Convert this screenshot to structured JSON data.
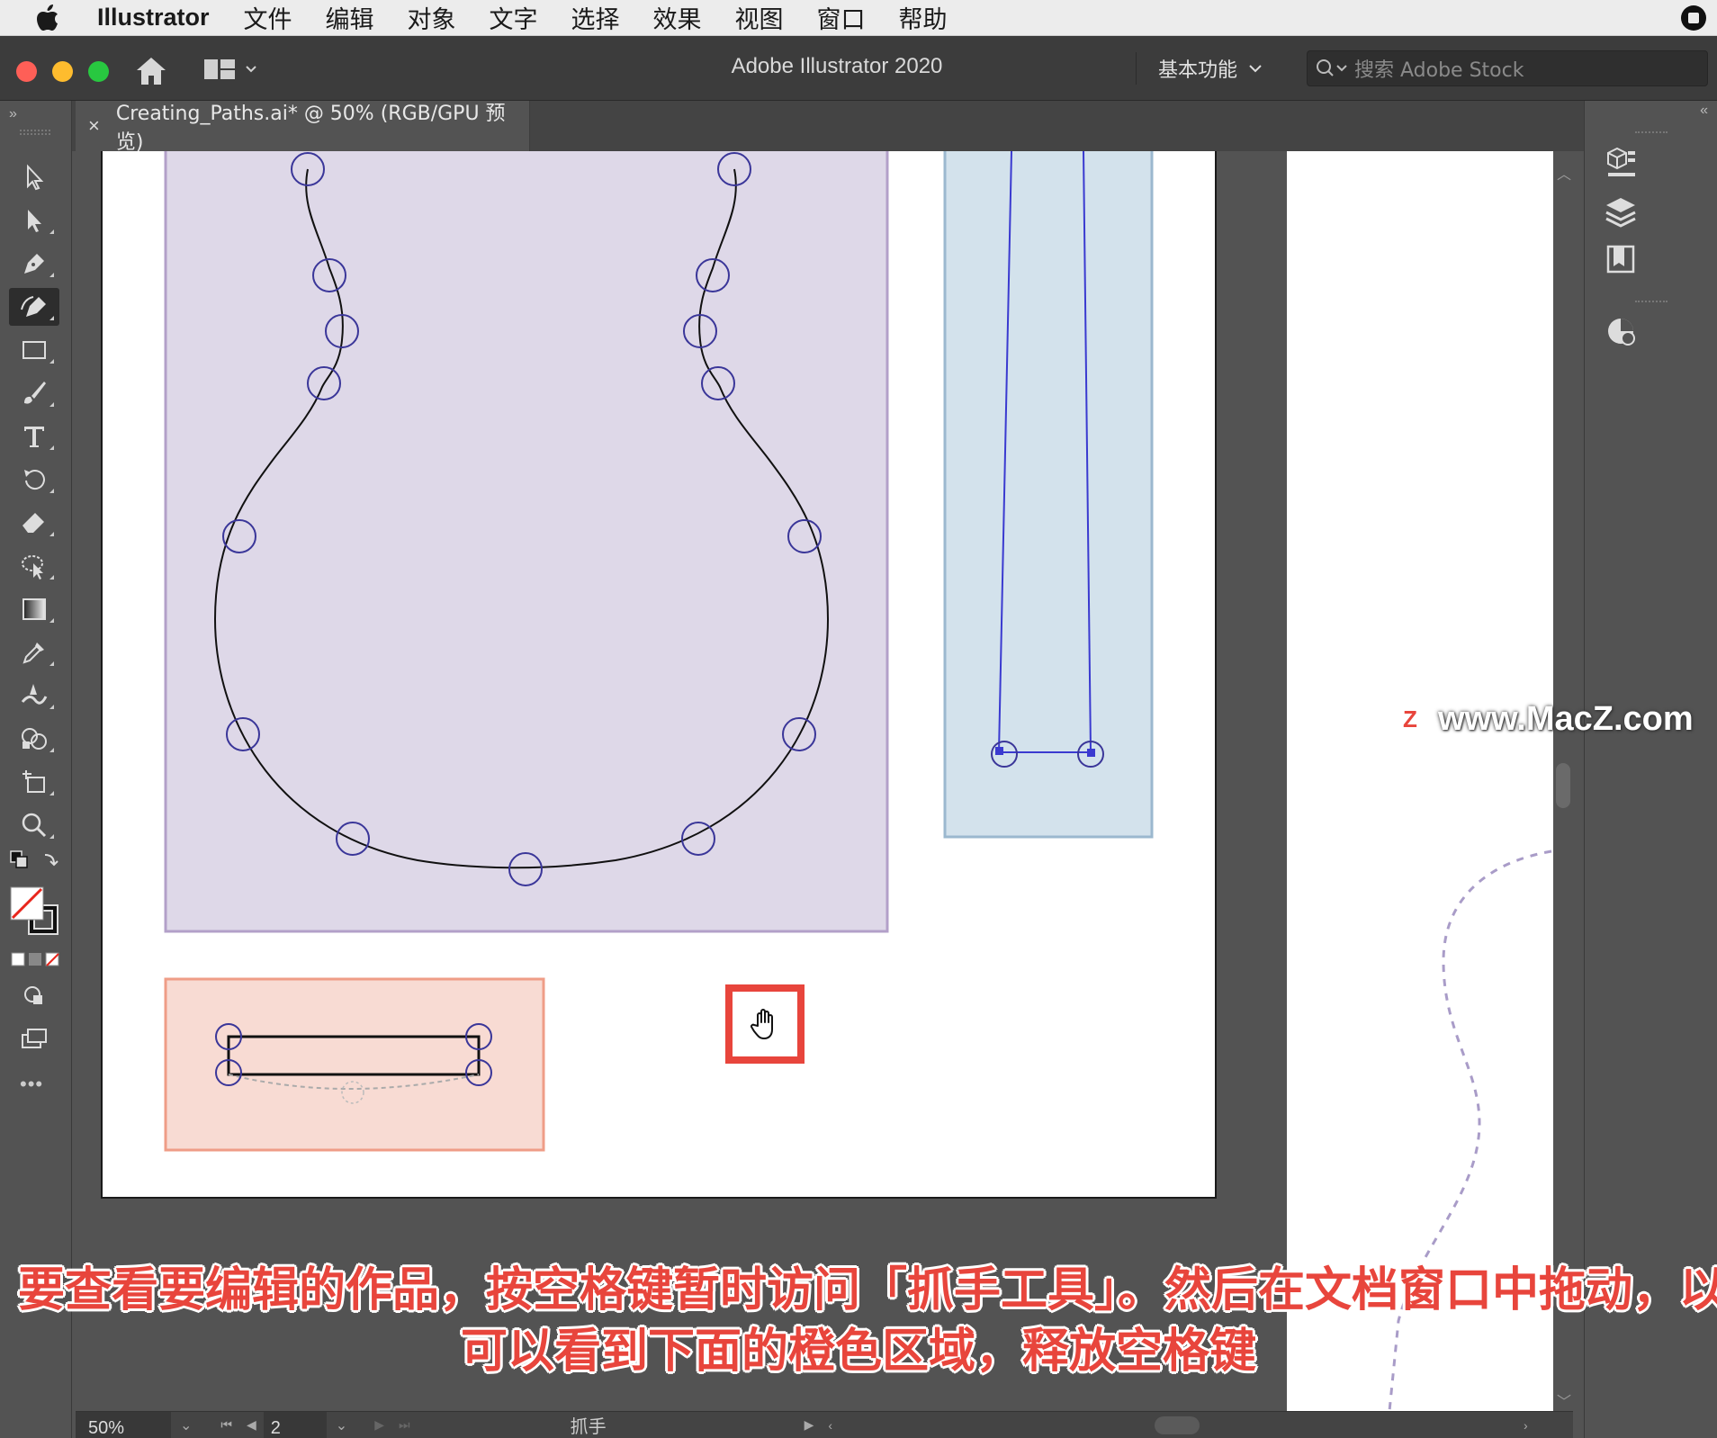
{
  "menubar": {
    "app_name": "Illustrator",
    "items": [
      "文件",
      "编辑",
      "对象",
      "文字",
      "选择",
      "效果",
      "视图",
      "窗口",
      "帮助"
    ]
  },
  "appbar": {
    "title": "Adobe Illustrator 2020",
    "workspace": "基本功能",
    "search_placeholder": "搜索 Adobe Stock"
  },
  "document": {
    "tab_name": "Creating_Paths.ai* @ 50% (RGB/GPU 预览)"
  },
  "toolbar": {
    "tools": [
      "selection-tool",
      "direct-selection-tool",
      "pen-tool",
      "curvature-tool",
      "rectangle-tool",
      "paintbrush-tool",
      "type-tool",
      "rotate-tool",
      "eraser-tool",
      "free-transform-tool",
      "gradient-tool",
      "eyedropper-tool",
      "width-tool",
      "shape-builder-tool",
      "artboard-tool",
      "zoom-tool"
    ],
    "active_tool": "curvature-tool",
    "more_label": "•••"
  },
  "status": {
    "zoom": "50%",
    "page": "2",
    "tool_name": "抓手"
  },
  "watermark": {
    "logo": "Z",
    "text": "www.MacZ.com"
  },
  "caption": {
    "line1": "要查看要编辑的作品，按空格键暂时访问「抓手工具」。然后在文档窗口中拖动，以便",
    "line2": "可以看到下面的橙色区域，释放空格键"
  },
  "colors": {
    "purple_fill": "#ded8e8",
    "purple_stroke": "#b3a0c9",
    "blue_fill": "#d3e2ec",
    "blue_stroke": "#9bb8cf",
    "orange_fill": "#f8dbd3",
    "orange_stroke": "#ef9d87",
    "anchor": "#3a3699",
    "highlight": "#e8453c"
  }
}
